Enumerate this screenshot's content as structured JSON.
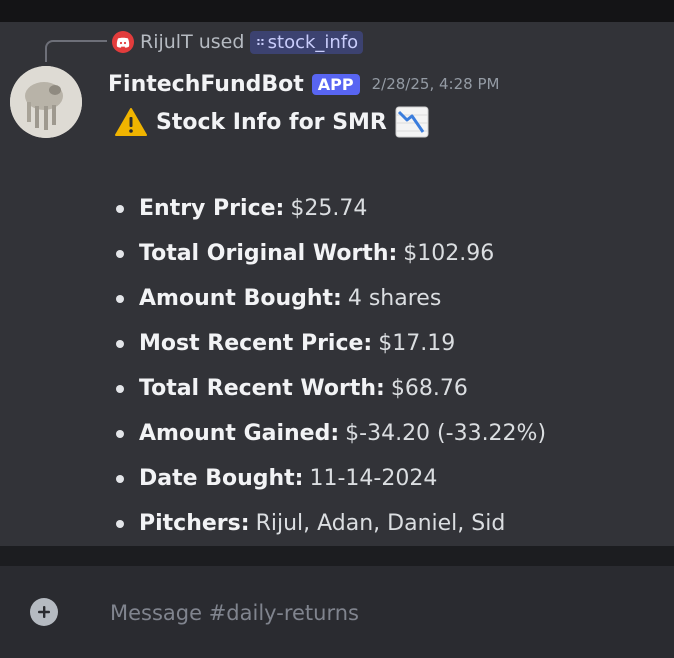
{
  "interaction": {
    "user": "RijulT",
    "verb": "used",
    "command": "stock_info"
  },
  "message": {
    "author": "FintechFundBot",
    "badge": "APP",
    "timestamp": "2/28/25, 4:28 PM",
    "title": "Stock Info for SMR",
    "fields": [
      {
        "label": "Entry Price:",
        "value": "$25.74"
      },
      {
        "label": "Total Original Worth:",
        "value": "$102.96"
      },
      {
        "label": "Amount Bought:",
        "value": "4 shares"
      },
      {
        "label": "Most Recent Price:",
        "value": "$17.19"
      },
      {
        "label": "Total Recent Worth:",
        "value": "$68.76"
      },
      {
        "label": "Amount Gained:",
        "value": "$-34.20 (-33.22%)"
      },
      {
        "label": "Date Bought:",
        "value": "11-14-2024"
      },
      {
        "label": "Pitchers:",
        "value": "Rijul, Adan, Daniel, Sid"
      }
    ]
  },
  "composer": {
    "placeholder": "Message #daily-returns"
  },
  "icons": {
    "title_prefix": "warning-icon",
    "title_suffix": "chart-decreasing-icon",
    "interaction": "app-icon",
    "composer": "plus-icon"
  },
  "colors": {
    "accent": "#5865f2",
    "background": "#323338",
    "app_badge": "#5865f2",
    "warning": "#f0b400"
  }
}
